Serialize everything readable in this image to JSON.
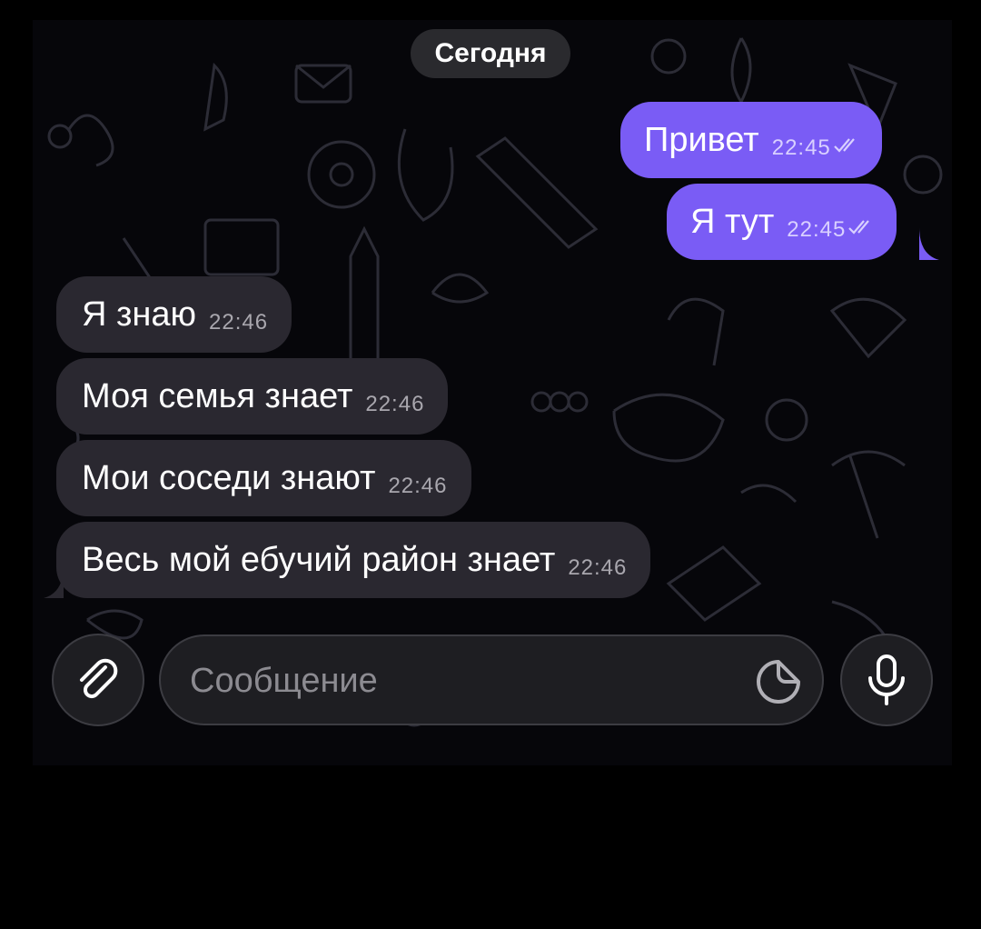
{
  "chat": {
    "date_label": "Сегодня",
    "outgoing": [
      {
        "text": "Привет",
        "time": "22:45"
      },
      {
        "text": "Я тут",
        "time": "22:45"
      }
    ],
    "incoming": [
      {
        "text": "Я знаю",
        "time": "22:46"
      },
      {
        "text": "Моя семья знает",
        "time": "22:46"
      },
      {
        "text": "Мои соседи знают",
        "time": "22:46"
      },
      {
        "text": "Весь мой ебучий район знает",
        "time": "22:46"
      }
    ]
  },
  "composer": {
    "placeholder": "Сообщение",
    "attach_icon": "paperclip-icon",
    "sticker_icon": "sticker-icon",
    "mic_icon": "microphone-icon"
  },
  "colors": {
    "outgoing_bubble": "#7a5cf5",
    "incoming_bubble": "#2a2830",
    "background": "#000000"
  }
}
